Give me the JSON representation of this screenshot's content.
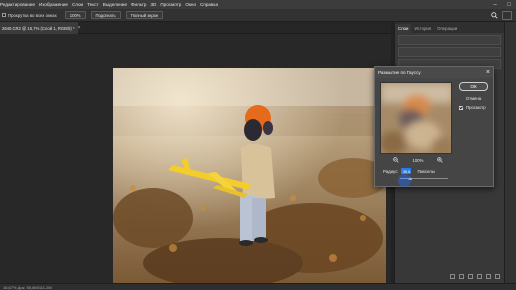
{
  "menubar": {
    "items": [
      "Редактирование",
      "Изображение",
      "Слои",
      "Текст",
      "Выделение",
      "Фильтр",
      "3D",
      "Просмотр",
      "Окно",
      "Справка"
    ],
    "window_controls": {
      "minimize": "–",
      "restore": "□"
    }
  },
  "options_bar": {
    "scroll_all_label": "Прокрутка во всех окнах",
    "zoom_value": "100%",
    "fit_label": "Подогнать",
    "fill_label": "Полный экран",
    "icons": [
      "search-icon",
      "share-icon"
    ]
  },
  "document": {
    "tab_label": "2640.CR2 @ 16,7% (Слой 1, RGB/8) *",
    "close_glyph": "×"
  },
  "panel": {
    "tabs": [
      "Слои",
      "История",
      "Операции"
    ],
    "active_tab": "Слои"
  },
  "status_bar": {
    "text": "16,67%    Док: 55,6M/111,2M"
  },
  "dialog": {
    "title": "Размытие по Гауссу",
    "close_glyph": "×",
    "ok_label": "ОК",
    "cancel_label": "Отмена",
    "preview_label": "Просмотр",
    "preview_checked": true,
    "zoom_level": "100%",
    "radius_label": "Радиус:",
    "radius_value": "35,6",
    "radius_units": "Пикселы",
    "radius_slider_fraction": 0.2
  },
  "colors": {
    "accent": "#2c7be5",
    "app_bg": "#282828",
    "panel_bg": "#383838",
    "dialog_bg": "#454545"
  }
}
